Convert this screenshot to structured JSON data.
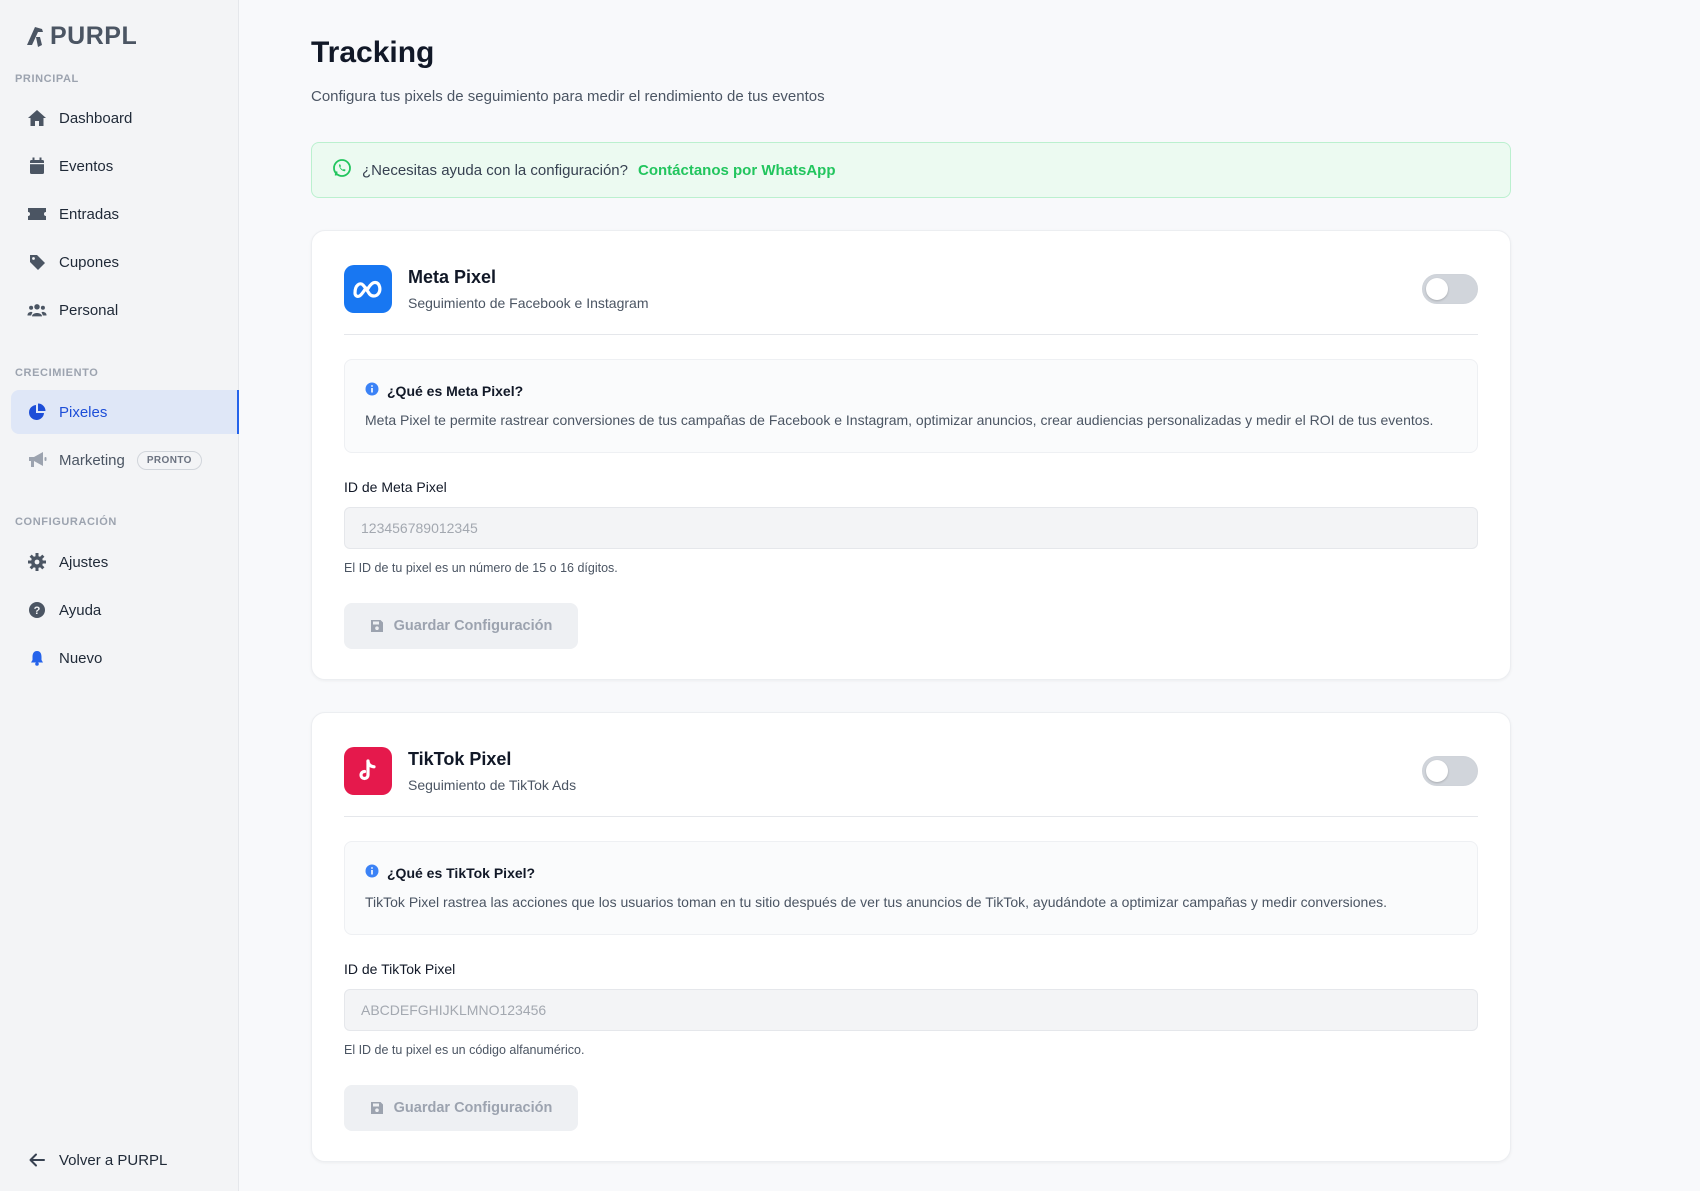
{
  "brand": {
    "name": "PURPL"
  },
  "sidebar": {
    "sections": [
      {
        "label": "PRINCIPAL"
      },
      {
        "label": "CRECIMIENTO"
      },
      {
        "label": "CONFIGURACIÓN"
      }
    ],
    "items": [
      {
        "label": "Dashboard",
        "icon": "home-icon"
      },
      {
        "label": "Eventos",
        "icon": "calendar-icon"
      },
      {
        "label": "Entradas",
        "icon": "ticket-icon"
      },
      {
        "label": "Cupones",
        "icon": "tag-icon"
      },
      {
        "label": "Personal",
        "icon": "users-icon"
      },
      {
        "label": "Pixeles",
        "icon": "pie-chart-icon",
        "active": true
      },
      {
        "label": "Marketing",
        "icon": "megaphone-icon",
        "badge": "PRONTO"
      },
      {
        "label": "Ajustes",
        "icon": "gear-icon"
      },
      {
        "label": "Ayuda",
        "icon": "question-icon"
      },
      {
        "label": "Nuevo",
        "icon": "bell-icon"
      }
    ],
    "back_label": "Volver a PURPL"
  },
  "page": {
    "title": "Tracking",
    "subtitle": "Configura tus pixels de seguimiento para medir el rendimiento de tus eventos"
  },
  "help": {
    "text": "¿Necesitas ayuda con la configuración?",
    "link": "Contáctanos por WhatsApp"
  },
  "cards": [
    {
      "title": "Meta Pixel",
      "subtitle": "Seguimiento de Facebook e Instagram",
      "enabled": false,
      "info_title": "¿Qué es Meta Pixel?",
      "info_text": "Meta Pixel te permite rastrear conversiones de tus campañas de Facebook e Instagram, optimizar anuncios, crear audiencias personalizadas y medir el ROI de tus eventos.",
      "field_label": "ID de Meta Pixel",
      "placeholder": "123456789012345",
      "hint": "El ID de tu pixel es un número de 15 o 16 dígitos.",
      "save_label": "Guardar Configuración",
      "color": "#1877f2"
    },
    {
      "title": "TikTok Pixel",
      "subtitle": "Seguimiento de TikTok Ads",
      "enabled": false,
      "info_title": "¿Qué es TikTok Pixel?",
      "info_text": "TikTok Pixel rastrea las acciones que los usuarios toman en tu sitio después de ver tus anuncios de TikTok, ayudándote a optimizar campañas y medir conversiones.",
      "field_label": "ID de TikTok Pixel",
      "placeholder": "ABCDEFGHIJKLMNO123456",
      "hint": "El ID de tu pixel es un código alfanumérico.",
      "save_label": "Guardar Configuración",
      "color": "#e5194c"
    }
  ]
}
